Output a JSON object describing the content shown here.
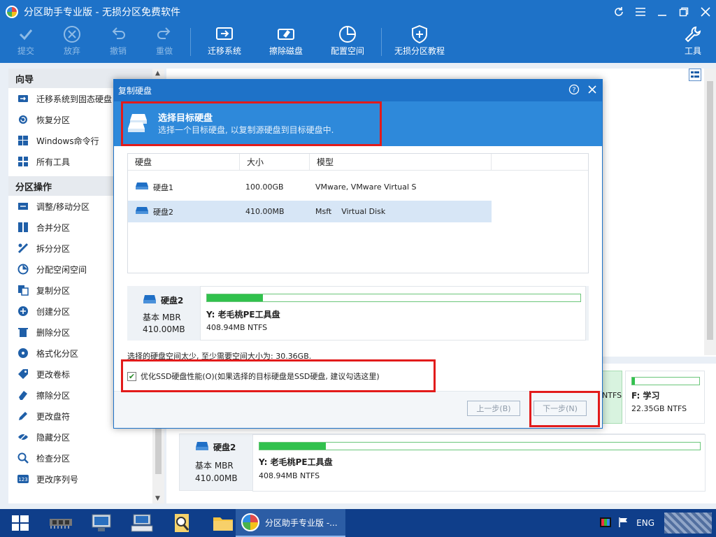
{
  "window": {
    "title": "分区助手专业版 - 无损分区免费软件"
  },
  "toolbar": {
    "items": [
      {
        "label": "提交",
        "icon": "check-icon",
        "enabled": false
      },
      {
        "label": "放弃",
        "icon": "cancel-icon",
        "enabled": false
      },
      {
        "label": "撤销",
        "icon": "undo-icon",
        "enabled": false
      },
      {
        "label": "重做",
        "icon": "redo-icon",
        "enabled": false
      },
      {
        "label": "迁移系统",
        "icon": "migrate-icon",
        "enabled": true
      },
      {
        "label": "擦除磁盘",
        "icon": "wipe-disk-icon",
        "enabled": true
      },
      {
        "label": "配置空间",
        "icon": "allocate-space-icon",
        "enabled": true
      },
      {
        "label": "无损分区教程",
        "icon": "shield-icon",
        "enabled": true
      }
    ],
    "tools_label": "工具"
  },
  "sidebar": {
    "wizard_title": "向导",
    "wizard_items": [
      {
        "label": "迁移系统到固态硬盘",
        "icon": "migrate-ssd-icon"
      },
      {
        "label": "恢复分区",
        "icon": "recover-partition-icon"
      },
      {
        "label": "Windows命令行",
        "icon": "windows-icon"
      },
      {
        "label": "所有工具",
        "icon": "tools-grid-icon"
      }
    ],
    "ops_title": "分区操作",
    "ops_items": [
      {
        "label": "调整/移动分区",
        "icon": "resize-icon"
      },
      {
        "label": "合并分区",
        "icon": "merge-icon"
      },
      {
        "label": "拆分分区",
        "icon": "split-icon"
      },
      {
        "label": "分配空闲空间",
        "icon": "allocate-icon"
      },
      {
        "label": "复制分区",
        "icon": "copy-icon"
      },
      {
        "label": "创建分区",
        "icon": "create-icon"
      },
      {
        "label": "删除分区",
        "icon": "delete-icon"
      },
      {
        "label": "格式化分区",
        "icon": "format-icon"
      },
      {
        "label": "更改卷标",
        "icon": "label-icon"
      },
      {
        "label": "擦除分区",
        "icon": "eraser-icon"
      },
      {
        "label": "更改盘符",
        "icon": "pencil-icon"
      },
      {
        "label": "隐藏分区",
        "icon": "hide-icon"
      },
      {
        "label": "检查分区",
        "icon": "check-partition-icon"
      },
      {
        "label": "更改序列号",
        "icon": "serial-icon"
      }
    ]
  },
  "background": {
    "partition_f": {
      "name": "F: 学习",
      "size": "22.35GB NTFS"
    },
    "partial_ntfs": "NTFS",
    "disk2": {
      "name": "硬盘2",
      "type": "基本 MBR",
      "size": "410.00MB"
    },
    "disk2_partition": {
      "name": "Y: 老毛桃PE工具盘",
      "size": "408.94MB NTFS"
    }
  },
  "dialog": {
    "title": "复制硬盘",
    "banner_title": "选择目标硬盘",
    "banner_subtitle": "选择一个目标硬盘, 以复制源硬盘到目标硬盘中.",
    "columns": [
      "硬盘",
      "大小",
      "模型"
    ],
    "rows": [
      {
        "disk": "硬盘1",
        "size": "100.00GB",
        "model": "VMware, VMware Virtual S",
        "selected": false
      },
      {
        "disk": "硬盘2",
        "size": "410.00MB",
        "model": "Msft    Virtual Disk",
        "selected": true
      }
    ],
    "summary": {
      "disk_name": "硬盘2",
      "disk_type": "基本 MBR",
      "disk_size": "410.00MB",
      "partition_name": "Y: 老毛桃PE工具盘",
      "partition_size": "408.94MB NTFS",
      "partition_used_fraction": 0.15
    },
    "note": "选择的硬盘空间太少, 至少需要空间大小为: 30.36GB.",
    "checkbox_label": "优化SSD硬盘性能(O)(如果选择的目标硬盘是SSD硬盘, 建议勾选这里)",
    "checkbox_checked": true,
    "back_label": "上一步(B)",
    "next_label": "下一步(N)"
  },
  "taskbar": {
    "active_label": "分区助手专业版 -...",
    "language": "ENG"
  },
  "colors": {
    "title_blue": "#1e72c8",
    "banner_blue": "#2e89da",
    "partition_green": "#31c14d",
    "highlight_red": "#e21b1b"
  }
}
